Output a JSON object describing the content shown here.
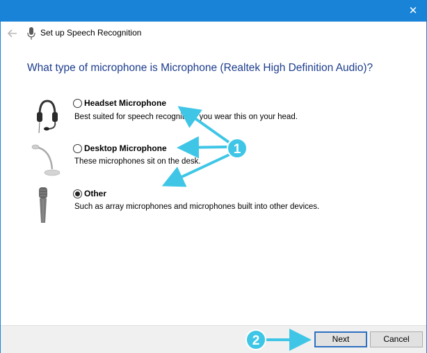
{
  "window": {
    "header_title": "Set up Speech Recognition",
    "question": "What type of microphone is Microphone (Realtek High Definition Audio)?"
  },
  "options": [
    {
      "label": "Headset Microphone",
      "description": "Best suited for speech recognition, you wear this on your head.",
      "icon": "headset-icon",
      "selected": false
    },
    {
      "label": "Desktop Microphone",
      "description": "These microphones sit on the desk.",
      "icon": "desktop-microphone-icon",
      "selected": false
    },
    {
      "label": "Other",
      "description": "Such as array microphones and microphones built into other devices.",
      "icon": "handheld-microphone-icon",
      "selected": true
    }
  ],
  "buttons": {
    "next": "Next",
    "cancel": "Cancel"
  },
  "annotations": [
    {
      "number": "1",
      "color": "#3fc6e6"
    },
    {
      "number": "2",
      "color": "#3fc6e6"
    }
  ],
  "colors": {
    "titlebar": "#1883d7",
    "question_text": "#1c3c8c",
    "callout": "#3fc6e6",
    "footer": "#f0f0f0"
  }
}
